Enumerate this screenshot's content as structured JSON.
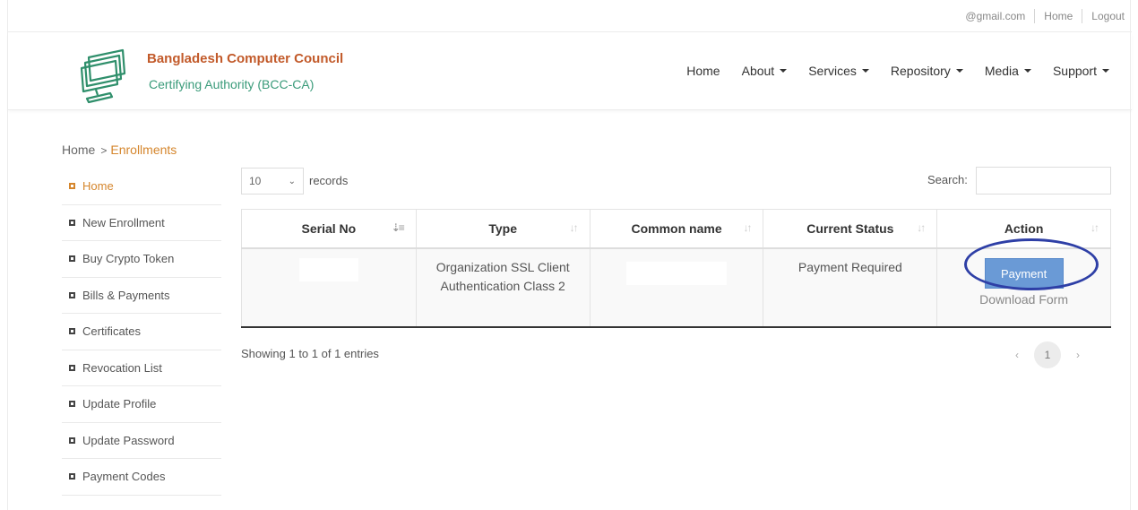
{
  "topbar": {
    "email": "@gmail.com",
    "home": "Home",
    "logout": "Logout"
  },
  "brand": {
    "title": "Bangladesh Computer Council",
    "subtitle": "Certifying Authority (BCC-CA)",
    "title_color": "#c25a2a",
    "subtitle_color": "#3a9b7a",
    "logo_icon": "monitor-logo-icon"
  },
  "nav": {
    "items": [
      {
        "label": "Home",
        "dropdown": false
      },
      {
        "label": "About",
        "dropdown": true
      },
      {
        "label": "Services",
        "dropdown": true
      },
      {
        "label": "Repository",
        "dropdown": true
      },
      {
        "label": "Media",
        "dropdown": true
      },
      {
        "label": "Support",
        "dropdown": true
      }
    ]
  },
  "breadcrumb": {
    "home": "Home",
    "separator": ">",
    "current": "Enrollments"
  },
  "sidebar": {
    "items": [
      {
        "label": "Home",
        "active": true
      },
      {
        "label": "New Enrollment",
        "active": false
      },
      {
        "label": "Buy Crypto Token",
        "active": false
      },
      {
        "label": "Bills & Payments",
        "active": false
      },
      {
        "label": "Certificates",
        "active": false
      },
      {
        "label": "Revocation List",
        "active": false
      },
      {
        "label": "Update Profile",
        "active": false
      },
      {
        "label": "Update Password",
        "active": false
      },
      {
        "label": "Payment Codes",
        "active": false
      }
    ],
    "accent_color": "#d5862d"
  },
  "table_controls": {
    "length_value": "10",
    "length_label": "records",
    "search_label": "Search:",
    "search_value": ""
  },
  "table": {
    "columns": [
      "Serial No",
      "Type",
      "Common name",
      "Current Status",
      "Action"
    ],
    "rows": [
      {
        "serial_no": "",
        "type": "Organization SSL Client Authentication Class 2",
        "common_name": "",
        "status": "Payment Required",
        "action_button": "Payment",
        "action_link": "Download Form"
      }
    ]
  },
  "footer": {
    "info": "Showing 1 to 1 of 1 entries",
    "prev": "‹",
    "page": "1",
    "next": "›"
  },
  "colors": {
    "payment_button": "#6a9ad6",
    "annotation_circle": "#2e3fa6"
  }
}
